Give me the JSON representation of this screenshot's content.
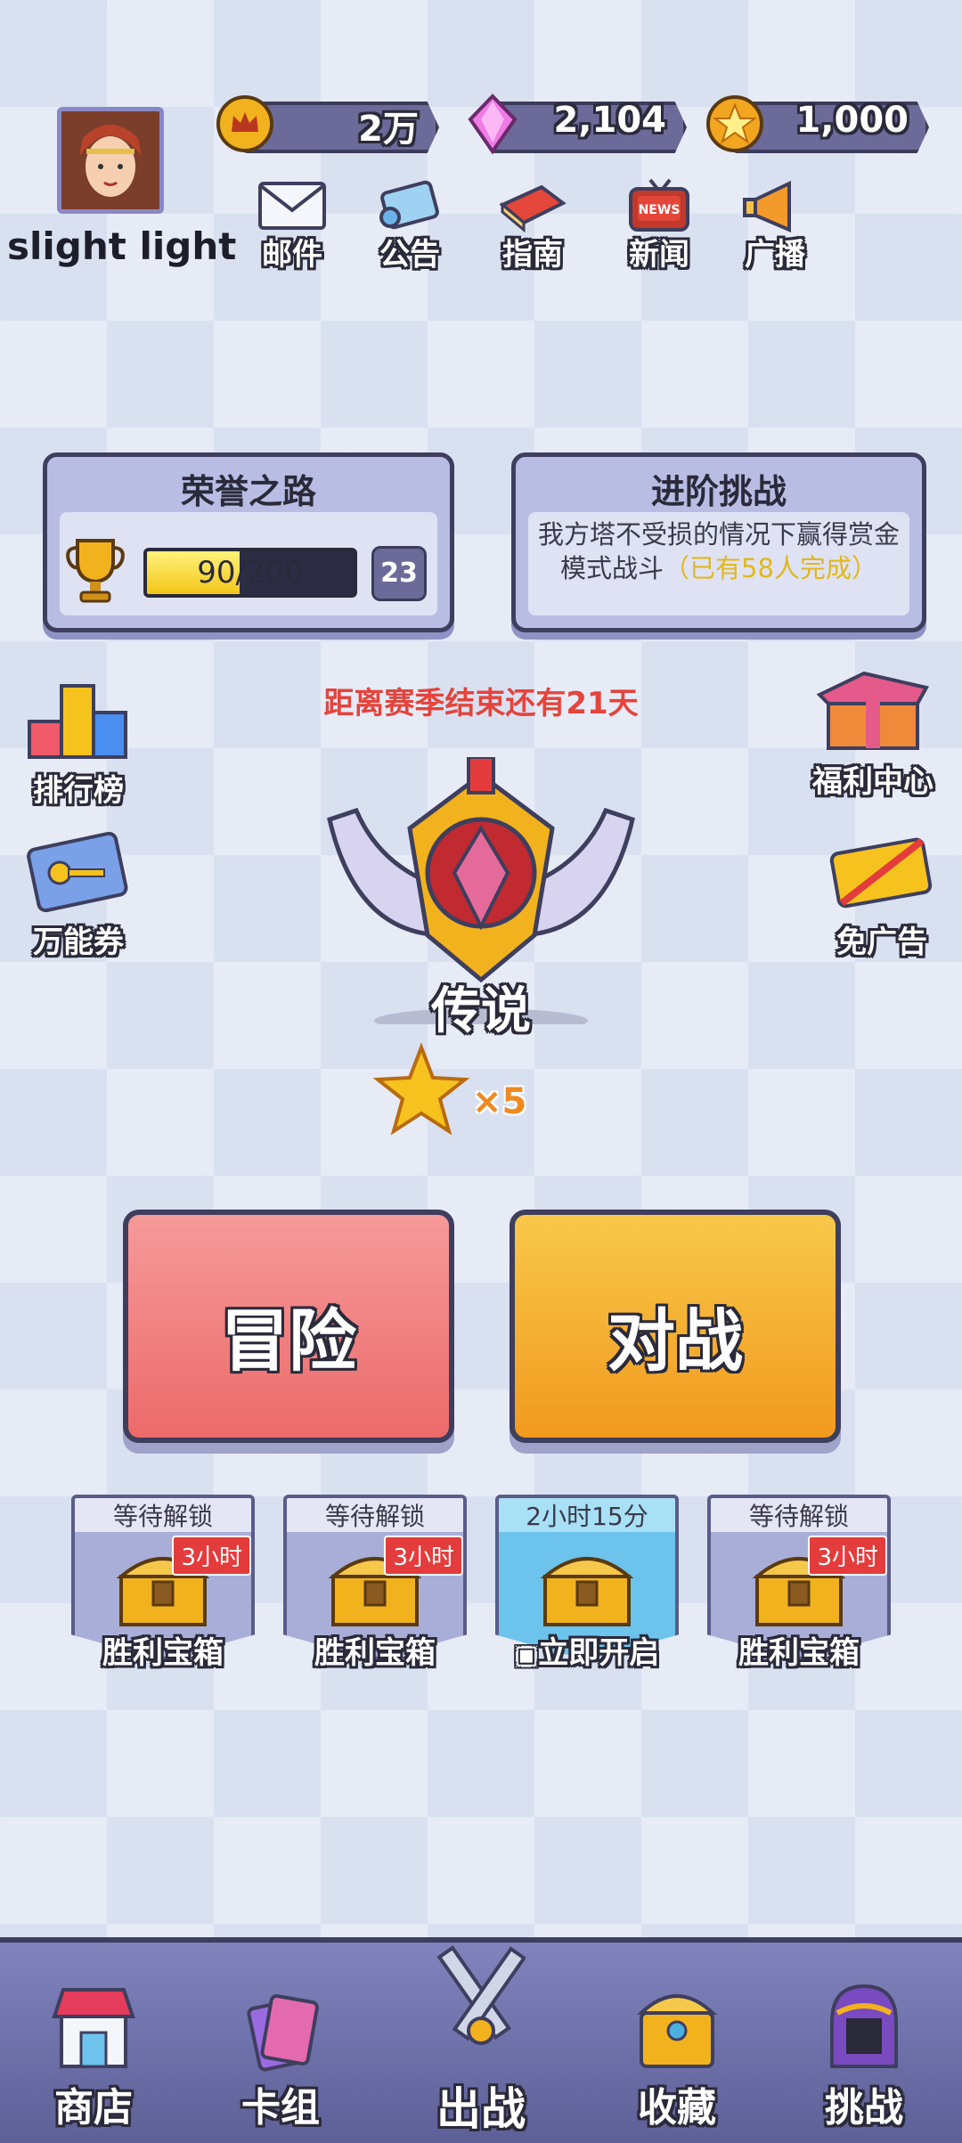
{
  "player": {
    "name": "slight light"
  },
  "currencies": [
    {
      "icon": "crown-coin-icon",
      "value": "2万"
    },
    {
      "icon": "pink-gem-icon",
      "value": "2,104"
    },
    {
      "icon": "star-medal-icon",
      "value": "1,000"
    }
  ],
  "top_menu": [
    {
      "icon": "mail-icon",
      "label": "邮件"
    },
    {
      "icon": "scroll-icon",
      "label": "公告"
    },
    {
      "icon": "guide-book-icon",
      "label": "指南"
    },
    {
      "icon": "news-tv-icon",
      "label": "新闻"
    },
    {
      "icon": "megaphone-icon",
      "label": "广播"
    }
  ],
  "honor_road": {
    "title": "荣誉之路",
    "progress_text": "90/200",
    "progress": 0.45,
    "level": "23"
  },
  "advanced_challenge": {
    "title": "进阶挑战",
    "desc_main": "我方塔不受损的情况下赢得赏金模式战斗",
    "desc_highlight": "（已有58人完成）"
  },
  "season_text": "距离赛季结束还有21天",
  "left_side": [
    {
      "icon": "leaderboard-icon",
      "label": "排行榜"
    },
    {
      "icon": "ticket-icon",
      "label": "万能券"
    }
  ],
  "right_side": [
    {
      "icon": "gift-box-icon",
      "label": "福利中心"
    },
    {
      "icon": "no-ads-icon",
      "label": "免广告"
    }
  ],
  "rank": {
    "name": "传说",
    "stars": "×5"
  },
  "buttons": {
    "adventure": "冒险",
    "battle": "对战"
  },
  "chests": [
    {
      "status": "等待解锁",
      "time_tag": "3小时",
      "name": "胜利宝箱"
    },
    {
      "status": "等待解锁",
      "time_tag": "3小时",
      "name": "胜利宝箱"
    },
    {
      "status": "2小时15分",
      "time_tag": "",
      "name": "立即开启"
    },
    {
      "status": "等待解锁",
      "time_tag": "3小时",
      "name": "胜利宝箱"
    }
  ],
  "bottom_nav": [
    {
      "icon": "shop-icon",
      "label": "商店"
    },
    {
      "icon": "card-deck-icon",
      "label": "卡组"
    },
    {
      "icon": "crossed-swords-icon",
      "label": "出战"
    },
    {
      "icon": "collection-chest-icon",
      "label": "收藏"
    },
    {
      "icon": "helmet-icon",
      "label": "挑战"
    }
  ],
  "colors": {
    "adventure": "#f07878",
    "battle": "#f5b52a",
    "season_text": "#e4443c",
    "panel": "#b9bde4"
  }
}
